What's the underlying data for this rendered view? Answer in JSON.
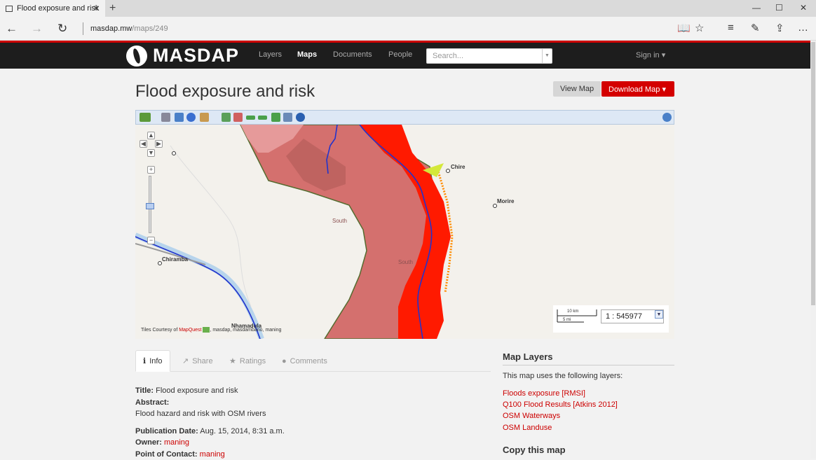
{
  "browser": {
    "tab_title": "Flood exposure and risk",
    "tab_close": "✕",
    "new_tab": "+",
    "url_host": "masdap.mw",
    "url_path": "/maps/249",
    "back": "←",
    "forward": "→",
    "refresh": "↻",
    "window_min": "—",
    "window_max": "☐",
    "window_close": "✕",
    "reading_view": "📖",
    "favorite": "☆",
    "hub": "≡",
    "notes": "✎",
    "share": "⇪",
    "more": "…"
  },
  "header": {
    "logo": "MASDAP",
    "nav": [
      "Layers",
      "Maps",
      "Documents",
      "People"
    ],
    "active_nav": "Maps",
    "search_placeholder": "Search...",
    "signin": "Sign in"
  },
  "page": {
    "title": "Flood exposure and risk",
    "view_map_btn": "View Map",
    "download_map_btn": "Download Map"
  },
  "map": {
    "places": [
      "Chire",
      "Morire",
      "South",
      "South",
      "Chiramba",
      "Nhamadula"
    ],
    "attribution_prefix": "Tiles Courtesy of ",
    "attribution_mq": "MapQuest",
    "attribution_suffix": ", masdap, masdambano, maning",
    "scale_km": "10 km",
    "scale_mi": "5 mi",
    "scale_value": "1 : 545977",
    "colors": {
      "land": "#f3f1ec",
      "landuse": "#d4706e",
      "landuse_light": "#e69a9a",
      "flood": "#ff1a00",
      "flood_edge": "#ff8c00",
      "river": "#2233cc",
      "border": "#556b2f"
    }
  },
  "tabs": [
    {
      "icon": "info-icon",
      "label": "Info",
      "glyph": "ℹ"
    },
    {
      "icon": "share-icon",
      "label": "Share",
      "glyph": "↗"
    },
    {
      "icon": "star-icon",
      "label": "Ratings",
      "glyph": "★"
    },
    {
      "icon": "comment-icon",
      "label": "Comments",
      "glyph": "●"
    }
  ],
  "info": {
    "title_label": "Title:",
    "title_value": "Flood exposure and risk",
    "abstract_label": "Abstract:",
    "abstract_value": "Flood hazard and risk with OSM rivers",
    "pubdate_label": "Publication Date:",
    "pubdate_value": "Aug. 15, 2014, 8:31 a.m.",
    "owner_label": "Owner:",
    "owner_value": "maning",
    "poc_label": "Point of Contact:",
    "poc_value": "maning"
  },
  "layers": {
    "title": "Map Layers",
    "description": "This map uses the following layers:",
    "items": [
      "Floods exposure [RMSI]",
      "Q100 Flood Results [Atkins 2012]",
      "OSM Waterways",
      "OSM Landuse"
    ],
    "copy_title": "Copy this map"
  }
}
